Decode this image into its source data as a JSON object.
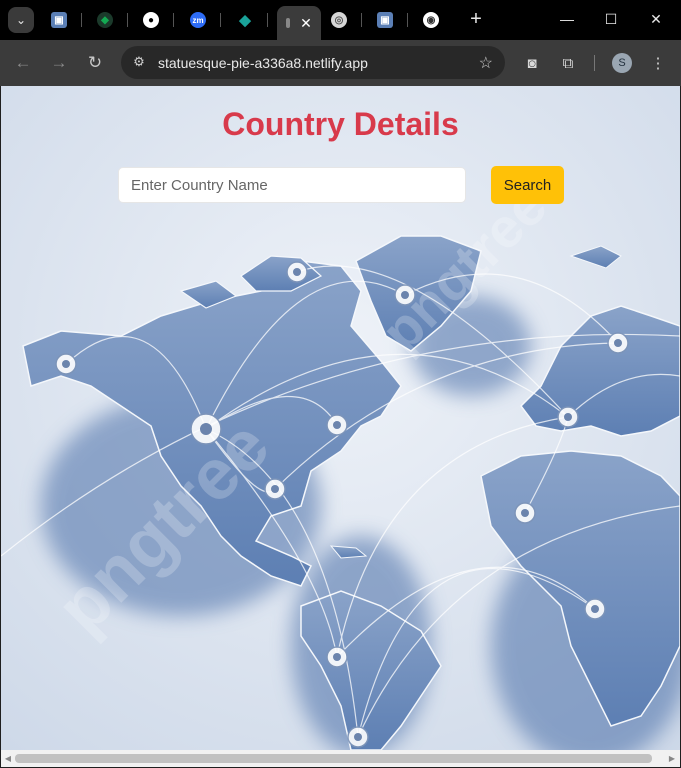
{
  "browser": {
    "tabs": [
      {
        "icon": "app-icon",
        "color": "#5b7fb5",
        "glyph": "▣"
      },
      {
        "icon": "mongodb-leaf-icon",
        "color": "#1b3a2b",
        "glyph": "◆"
      },
      {
        "icon": "github-icon",
        "color": "#000000",
        "glyph": "●"
      },
      {
        "icon": "zoom-icon",
        "color": "#2d6cf6",
        "glyph": "zm"
      },
      {
        "icon": "diamond-icon",
        "color": "#1aa39a",
        "glyph": "◆"
      },
      {
        "icon": "active-tab",
        "color": "#3b3b3b",
        "glyph": ""
      },
      {
        "icon": "globe-icon",
        "color": "#d6d6d6",
        "glyph": "◎"
      },
      {
        "icon": "app-icon",
        "color": "#5b7fb5",
        "glyph": "▣"
      },
      {
        "icon": "chrome-icon",
        "color": "#ffffff",
        "glyph": "◉"
      }
    ],
    "url": "statuesque-pie-a336a8.netlify.app",
    "profile_initial": "S"
  },
  "page": {
    "title": "Country Details",
    "search": {
      "placeholder": "Enter Country Name",
      "value": "",
      "button_label": "Search"
    },
    "colors": {
      "title": "#d83a4b",
      "button": "#ffc107"
    }
  }
}
